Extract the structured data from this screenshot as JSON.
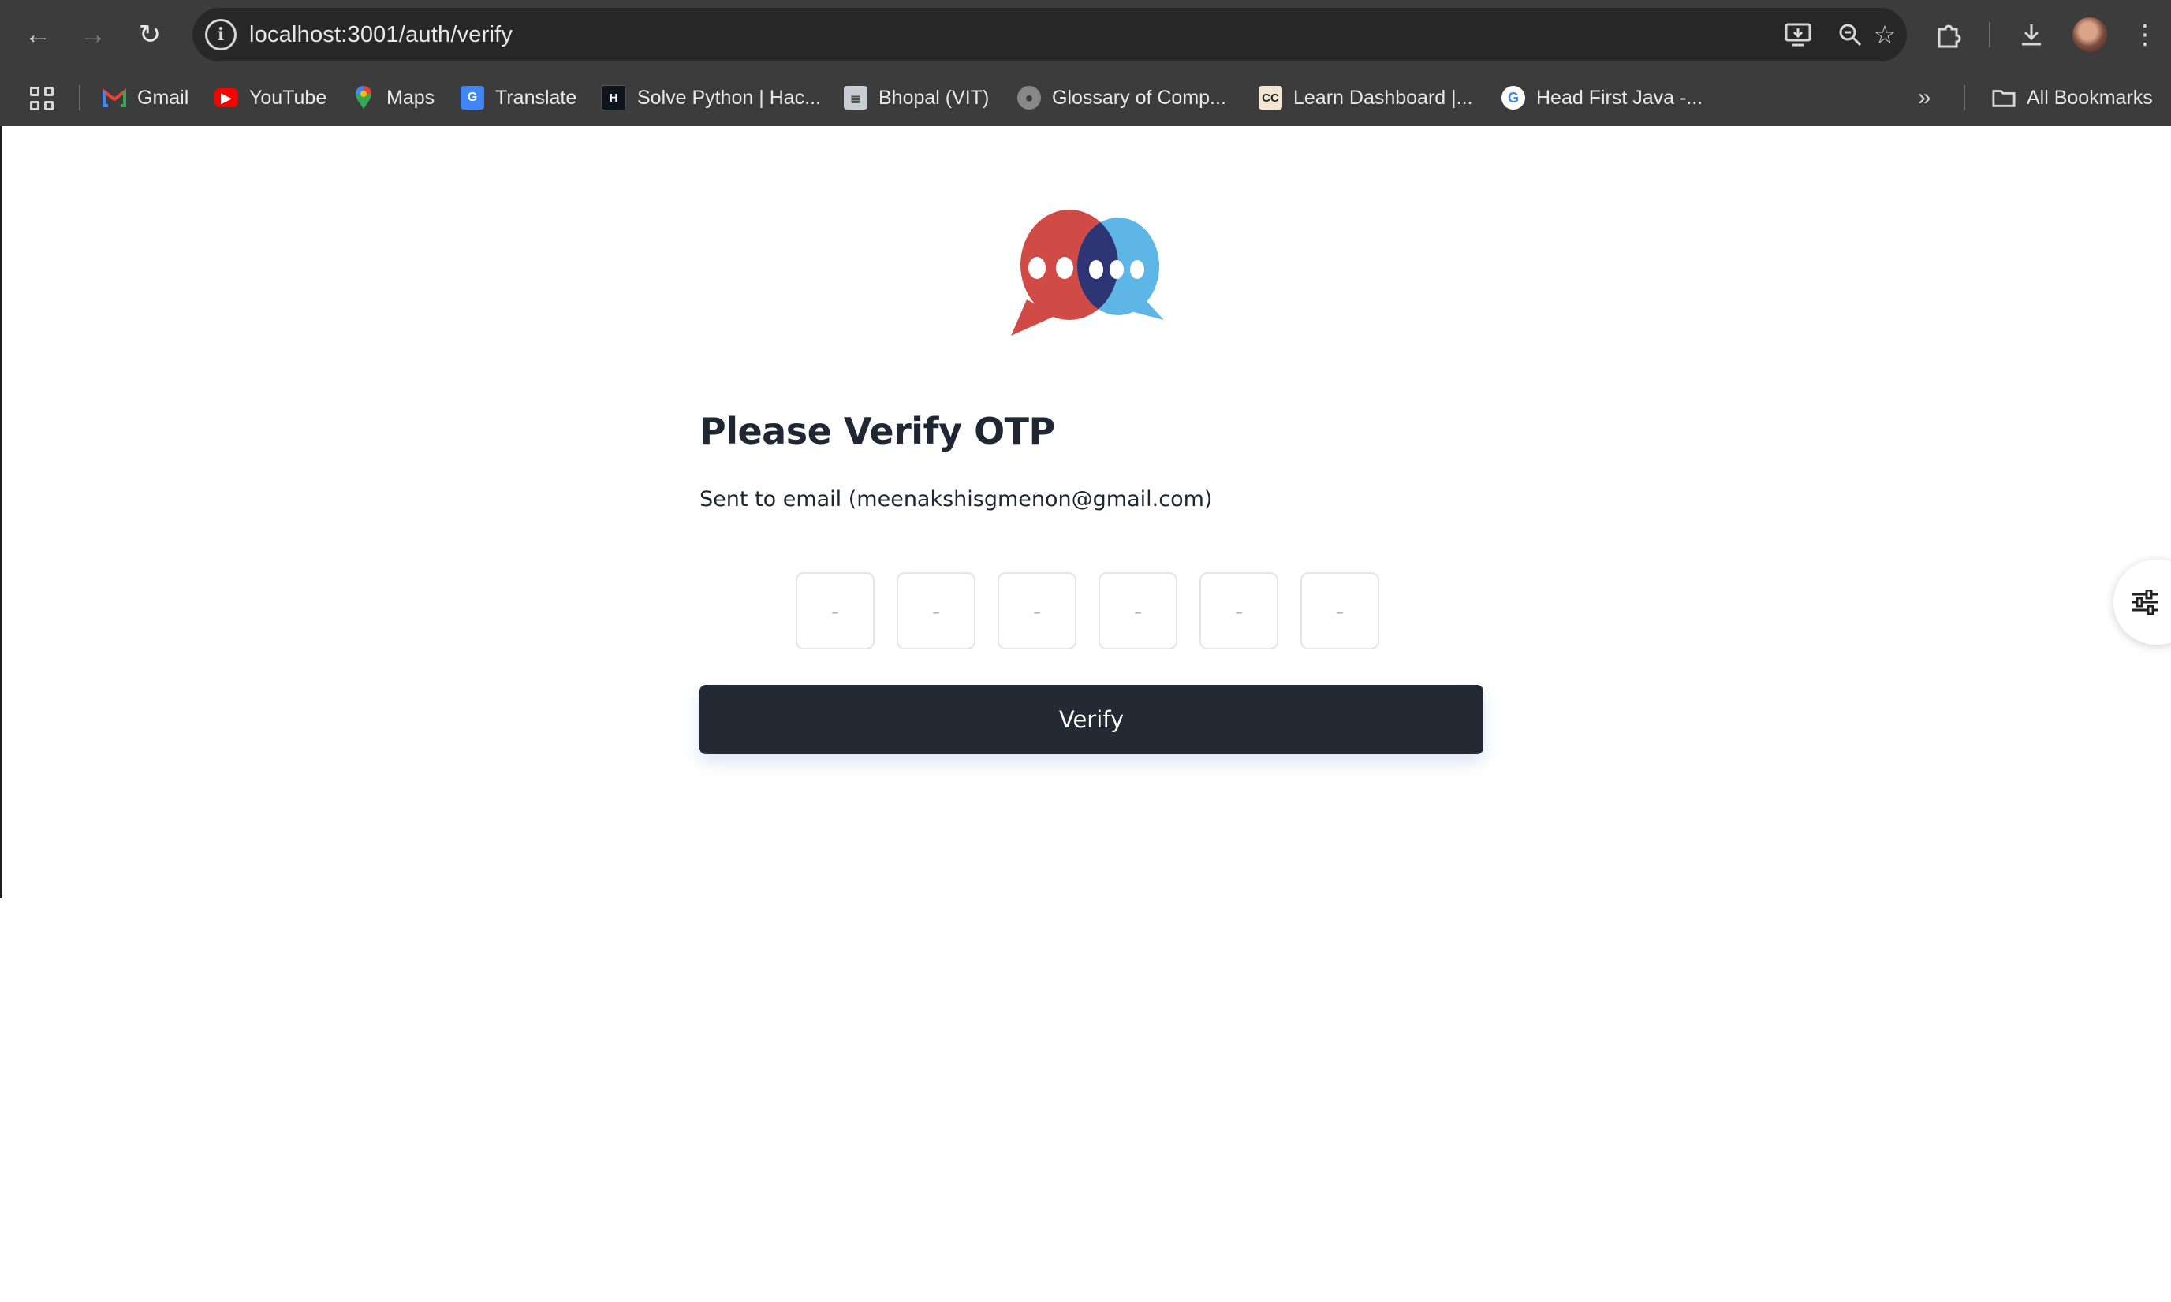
{
  "browser": {
    "url": "localhost:3001/auth/verify",
    "bookmarks": [
      {
        "label": "Gmail",
        "icon": "gmail-icon"
      },
      {
        "label": "YouTube",
        "icon": "youtube-icon"
      },
      {
        "label": "Maps",
        "icon": "maps-icon"
      },
      {
        "label": "Translate",
        "icon": "translate-icon"
      },
      {
        "label": "Solve Python | Hac...",
        "icon": "hackerrank-icon"
      },
      {
        "label": "Bhopal (VIT)",
        "icon": "vit-icon"
      },
      {
        "label": "Glossary of Comp...",
        "icon": "globe-icon"
      },
      {
        "label": "Learn Dashboard |...",
        "icon": "codecademy-icon"
      },
      {
        "label": "Head First Java -...",
        "icon": "google-icon"
      }
    ],
    "all_bookmarks_label": "All Bookmarks"
  },
  "verify": {
    "title": "Please Verify OTP",
    "subtitle": "Sent to email (meenakshisgmenon@gmail.com)",
    "otp_placeholder": "-",
    "otp_values": [
      "",
      "",
      "",
      "",
      "",
      ""
    ],
    "button_label": "Verify"
  },
  "colors": {
    "logo_red": "#d04a46",
    "logo_blue": "#5db6e6",
    "logo_overlap": "#2e3575",
    "button_bg": "#232a34",
    "title_text": "#1f2733"
  }
}
